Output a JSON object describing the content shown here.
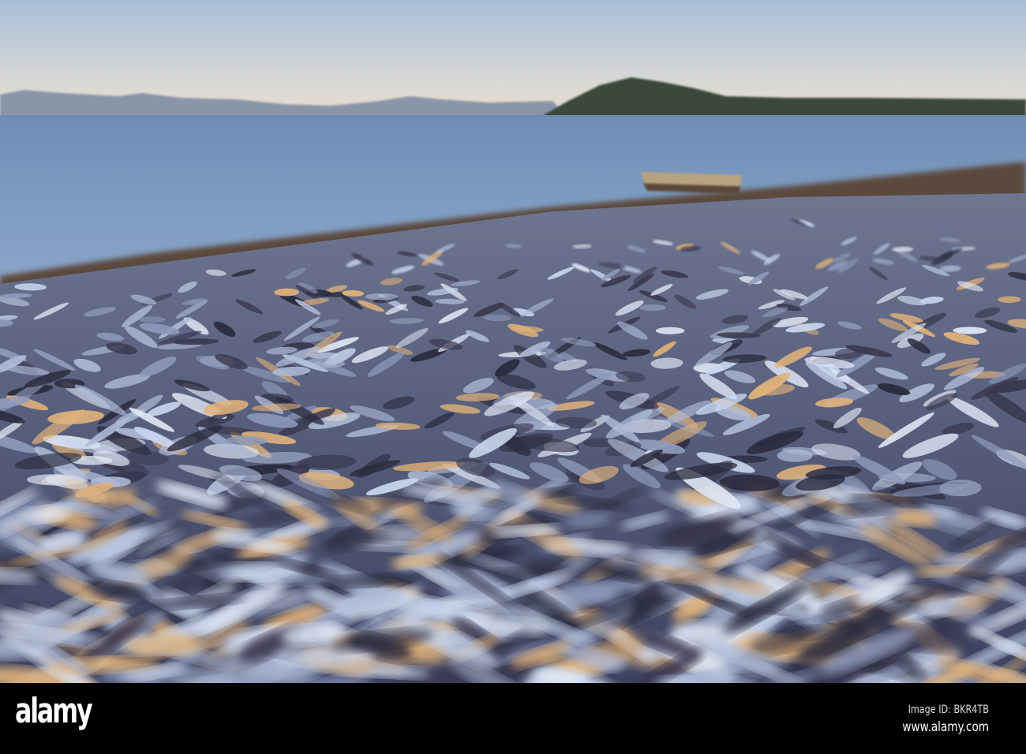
{
  "watermark": {
    "logo_text": "alamy",
    "image_id": "Image ID: BKR4TB",
    "website": "www.alamy.com"
  },
  "colors": {
    "sky_top": "#a9bfd6",
    "sky_horizon": "#e9dccb",
    "water": "#7a98bd",
    "fish_shadow": "#2a2a3c",
    "fish_highlight": "#c9d6ee",
    "warm_glint": "#e0b27a"
  }
}
